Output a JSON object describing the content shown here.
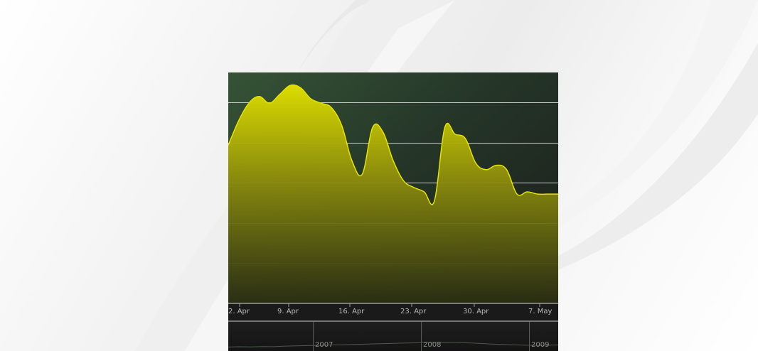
{
  "chart_data": {
    "type": "area",
    "title": "",
    "xlabel": "",
    "ylabel": "",
    "grid": true,
    "x_tick_labels": [
      "2. Apr",
      "9. Apr",
      "16. Apr",
      "23. Apr",
      "30. Apr",
      "7. May"
    ],
    "navigator_labels": [
      "2007",
      "2008",
      "2009"
    ],
    "ylim": [
      0,
      1
    ],
    "series": [
      {
        "values": [
          0.71,
          0.82,
          0.9,
          0.93,
          0.9,
          0.94,
          0.98,
          0.97,
          0.92,
          0.9,
          0.88,
          0.8,
          0.64,
          0.58,
          0.79,
          0.77,
          0.64,
          0.55,
          0.52,
          0.5,
          0.46,
          0.79,
          0.76,
          0.74,
          0.63,
          0.6,
          0.62,
          0.6,
          0.49,
          0.5,
          0.49,
          0.49,
          0.49
        ]
      }
    ],
    "navigator_series": [
      0.2,
      0.22,
      0.21,
      0.24,
      0.23,
      0.27,
      0.29,
      0.31,
      0.33,
      0.36,
      0.38,
      0.4,
      0.42,
      0.45,
      0.47,
      0.5,
      0.52,
      0.55,
      0.56,
      0.58,
      0.56,
      0.53,
      0.49,
      0.44,
      0.4,
      0.37,
      0.35,
      0.33,
      0.34,
      0.36
    ],
    "colors": {
      "area_top": "#dcdc00",
      "area_bottom": "#2a2e12",
      "line": "#e4e400",
      "grid": "#e8e8e8",
      "plot_bg_top": "#355336",
      "plot_bg_bottom": "#191919"
    }
  }
}
